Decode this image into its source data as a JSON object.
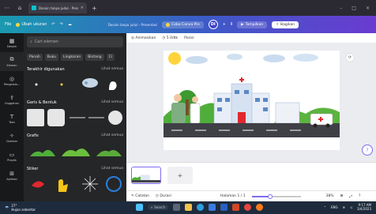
{
  "browser": {
    "tab_title": "Desain tanpa judul - Presentasi",
    "tab_close": "×",
    "new_tab": "+",
    "menu": "⋯",
    "home_icon": "⌂",
    "window_controls": [
      "–",
      "□",
      "×"
    ]
  },
  "header": {
    "file": "File",
    "resize": "Ubah ukuran",
    "undo": "↶",
    "redo": "↷",
    "cloud": "☁",
    "doc_title": "Desain tanpa judul - Presentasi",
    "pro_cta": "Coba Canva Pro",
    "avatar_initials": "DI",
    "add_user": "+",
    "stats_icon": "⫴",
    "present": "Tampilkan",
    "share": "Bagikan"
  },
  "rail": [
    {
      "icon": "▦",
      "label": "Desain"
    },
    {
      "icon": "⧉",
      "label": "Elemen"
    },
    {
      "icon": "◎",
      "label": "Pengelola..."
    },
    {
      "icon": "⇪",
      "label": "Unggahan"
    },
    {
      "icon": "T",
      "label": "Teks"
    },
    {
      "icon": "✧",
      "label": "Gambar"
    },
    {
      "icon": "▭",
      "label": "Proyek"
    },
    {
      "icon": "⊞",
      "label": "Aplikasi"
    }
  ],
  "panel": {
    "search_placeholder": "Cari elemen",
    "chips": [
      "Panah",
      "Buku",
      "Lingkaran",
      "Bintang",
      "Ci"
    ],
    "sections": [
      {
        "title": "Terakhir digunakan",
        "see_all": "Lihat semua"
      },
      {
        "title": "Garis & Bentuk",
        "see_all": "Lihat semua"
      },
      {
        "title": "Grafis",
        "see_all": "Lihat semua"
      },
      {
        "title": "Stiker",
        "see_all": "Lihat semua"
      }
    ],
    "collapse_icon": "‹"
  },
  "editor": {
    "animate": "Animasikan",
    "duration": "5.0dtk",
    "position": "Posisi",
    "page_tool_icon": "⟳",
    "add_page": "+",
    "help": "?"
  },
  "footer": {
    "notes": "Catatan",
    "timer": "Durasi",
    "page_indicator": "Halaman 1 / 1",
    "zoom": "38%",
    "zoom_fraction": 0.38
  },
  "taskbar": {
    "temp": "27°",
    "weather": "Hujan sebentar",
    "search": "Search",
    "time": "9:17 AM",
    "date": "3/4/2023",
    "lang": "ENG"
  },
  "colors": {
    "accent": "#7d6cf0",
    "header_start": "#1a9ab0",
    "header_end": "#6a3bd1",
    "panel_bg": "#252627"
  }
}
